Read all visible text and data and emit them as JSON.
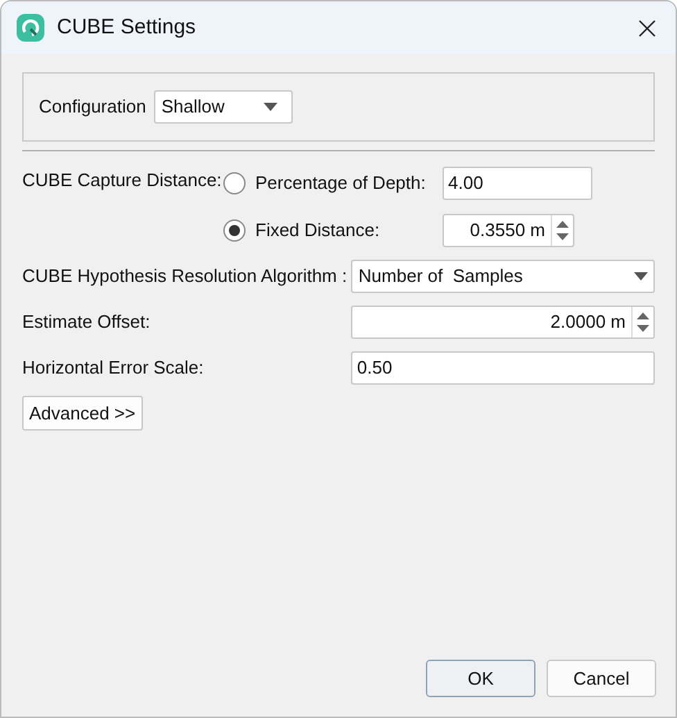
{
  "window": {
    "title": "CUBE Settings"
  },
  "configuration": {
    "label": "Configuration",
    "value": "Shallow"
  },
  "capture_distance": {
    "label": "CUBE Capture Distance:",
    "options": [
      {
        "label": "Percentage of Depth:",
        "selected": false,
        "kind": "text",
        "value": "4.00"
      },
      {
        "label": "Fixed Distance:",
        "selected": true,
        "kind": "spin",
        "value": "0.3550 m"
      }
    ]
  },
  "fields": [
    {
      "label": "CUBE Hypothesis Resolution Algorithm :",
      "kind": "dropdown",
      "value": "Number of  Samples"
    },
    {
      "label": "Estimate Offset:",
      "kind": "spin",
      "value": "2.0000 m"
    },
    {
      "label": "Horizontal Error Scale:",
      "kind": "text",
      "value": "0.50"
    }
  ],
  "advanced_button": "Advanced >>",
  "buttons": [
    {
      "label": "OK",
      "kind": "default"
    },
    {
      "label": "Cancel",
      "kind": "normal"
    }
  ]
}
